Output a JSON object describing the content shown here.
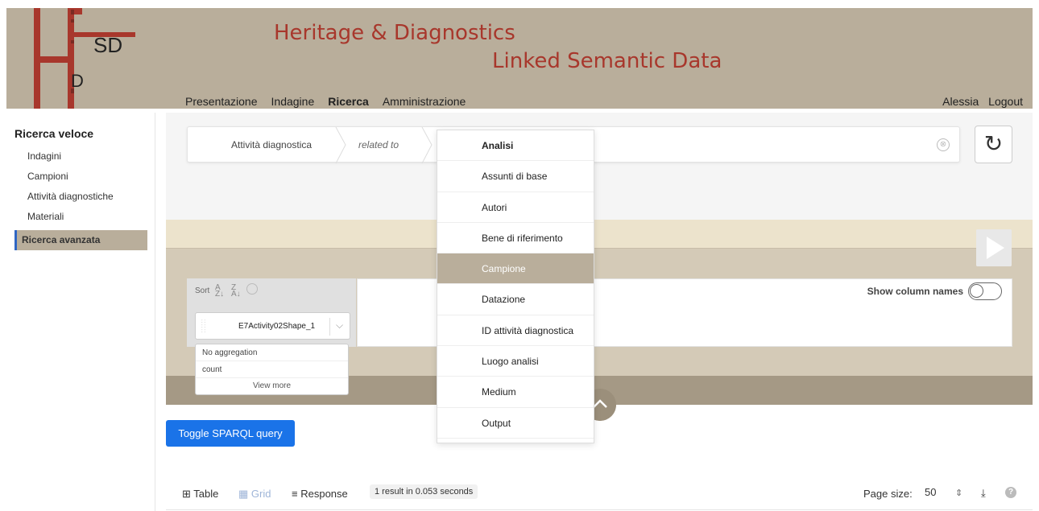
{
  "header": {
    "logo_text_sd": "SD",
    "logo_text_d": "D",
    "title_line1": "Heritage & Diagnostics",
    "title_line2": "Linked Semantic Data",
    "nav": [
      "Presentazione",
      "Indagine",
      "Ricerca",
      "Amministrazione"
    ],
    "active_nav": "Ricerca",
    "user": "Alessia",
    "logout": "Logout"
  },
  "sidebar": {
    "title": "Ricerca veloce",
    "items": [
      "Indagini",
      "Campioni",
      "Attività diagnostiche",
      "Materiali"
    ],
    "active_item": "Ricerca avanzata"
  },
  "query": {
    "crumb1": "Attività diagnostica",
    "crumb2": "related to",
    "clear_icon": "⊗",
    "refresh_icon": "↻"
  },
  "dropdown": {
    "items": [
      "Analisi",
      "Assunti di base",
      "Autori",
      "Bene di riferimento",
      "Campione",
      "Datazione",
      "ID attività diagnostica",
      "Luogo analisi",
      "Medium",
      "Output"
    ],
    "hover_item": "Campione"
  },
  "sort_panel": {
    "label": "Sort",
    "variable": "E7Activity02Shape_1"
  },
  "aggregation": {
    "items": [
      "No aggregation",
      "count"
    ],
    "more": "View more"
  },
  "columns": {
    "show_label": "Show column names"
  },
  "sparql_button": "Toggle SPARQL query",
  "results": {
    "tab_table": "Table",
    "tab_grid": "Grid",
    "tab_response": "Response",
    "count": "1 result in 0.053 seconds",
    "page_size_label": "Page size:",
    "page_size_value": "50"
  },
  "colors": {
    "header_bg": "#b9ae9b",
    "title_red": "#a8372c",
    "accent_blue": "#1a73e8"
  }
}
